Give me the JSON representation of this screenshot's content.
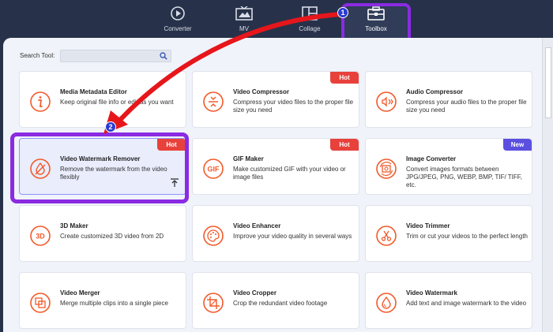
{
  "nav": {
    "tabs": [
      {
        "label": "Converter",
        "icon": "converter-icon"
      },
      {
        "label": "MV",
        "icon": "mv-icon"
      },
      {
        "label": "Collage",
        "icon": "collage-icon"
      },
      {
        "label": "Toolbox",
        "icon": "toolbox-icon",
        "active": true
      }
    ]
  },
  "search": {
    "label": "Search Tool:",
    "value": "",
    "placeholder": ""
  },
  "tools": [
    {
      "title": "Media Metadata Editor",
      "desc": "Keep original file info or edit as you want",
      "icon": "info-icon",
      "badge": ""
    },
    {
      "title": "Video Compressor",
      "desc": "Compress your video files to the proper file size you need",
      "icon": "compress-icon",
      "badge": "Hot"
    },
    {
      "title": "Audio Compressor",
      "desc": "Compress your audio files to the proper file size you need",
      "icon": "audio-compress-icon",
      "badge": ""
    },
    {
      "title": "Video Watermark Remover",
      "desc": "Remove the watermark from the video flexibly",
      "icon": "watermark-remove-icon",
      "badge": "Hot"
    },
    {
      "title": "GIF Maker",
      "desc": "Make customized GIF with your video or image files",
      "icon": "gif-icon",
      "badge": "Hot"
    },
    {
      "title": "Image Converter",
      "desc": "Convert images formats between JPG/JPEG, PNG, WEBP, BMP, TIF/ TIFF, etc.",
      "icon": "image-convert-icon",
      "badge": "New"
    },
    {
      "title": "3D Maker",
      "desc": "Create customized 3D video from 2D",
      "icon": "3d-icon",
      "badge": ""
    },
    {
      "title": "Video Enhancer",
      "desc": "Improve your video quality in several ways",
      "icon": "palette-icon",
      "badge": ""
    },
    {
      "title": "Video Trimmer",
      "desc": "Trim or cut your videos to the perfect length",
      "icon": "scissors-icon",
      "badge": ""
    },
    {
      "title": "Video Merger",
      "desc": "Merge multiple clips into a single piece",
      "icon": "merge-icon",
      "badge": ""
    },
    {
      "title": "Video Cropper",
      "desc": "Crop the redundant video footage",
      "icon": "crop-icon",
      "badge": ""
    },
    {
      "title": "Video Watermark",
      "desc": "Add text and image watermark to the video",
      "icon": "droplet-icon",
      "badge": ""
    }
  ],
  "annotations": {
    "step1": "1",
    "step2": "2"
  },
  "icons": {
    "3d_text": "3D",
    "gif_text": "GIF"
  },
  "colors": {
    "accent": "#f25a2b",
    "hot": "#e8413c",
    "new": "#5b4fe0",
    "highlight": "#8a2be2",
    "arrow": "#e6161b"
  }
}
